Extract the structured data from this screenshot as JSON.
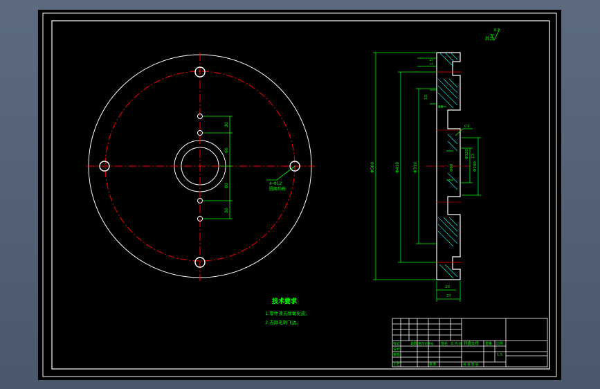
{
  "notes": {
    "heading": "技术要求",
    "item1": "1.零件须去除氧化皮。",
    "item2": "2.去除毛刺飞边。"
  },
  "surface_finish": {
    "label": "其余",
    "value": "6.3"
  },
  "front_view": {
    "dims": {
      "d1": "30",
      "d2": "60",
      "d3": "60",
      "d4": "30"
    },
    "hole_note_line1": "4-Φ12",
    "hole_note_line2": "圆周均布"
  },
  "section_view": {
    "dims": {
      "overall_dia": "Φ500",
      "bolt_circle_dia": "Φ410",
      "recess_dia": "Φ310",
      "bore_dia": "Φ80",
      "hub_dia": "Φ100",
      "step_dia": "Φ120",
      "bottom_inner": "20",
      "bottom_outer": "27",
      "top_side": "1.5",
      "top_slot": "10",
      "recess_depth": "10",
      "bore_len": "13",
      "chamfer": "C1"
    }
  },
  "title_block": {
    "row_a": [
      "标记",
      "处数",
      "更改文件号",
      "签名",
      "年.月.日"
    ],
    "part_name": "转盘支撑",
    "drawn": "设计",
    "checked": "审核",
    "process": "工艺",
    "approved": "批准",
    "scale_label": "比例",
    "weight_label": "重量",
    "scale_value": "1:5",
    "sheet": "共 张 第 张"
  },
  "colors": {
    "background": "#000000",
    "linework": "#ffffff",
    "centerline": "#ff0000",
    "dimension": "#00ff00",
    "hatch": "#00ffff",
    "text": "#00ff00"
  }
}
